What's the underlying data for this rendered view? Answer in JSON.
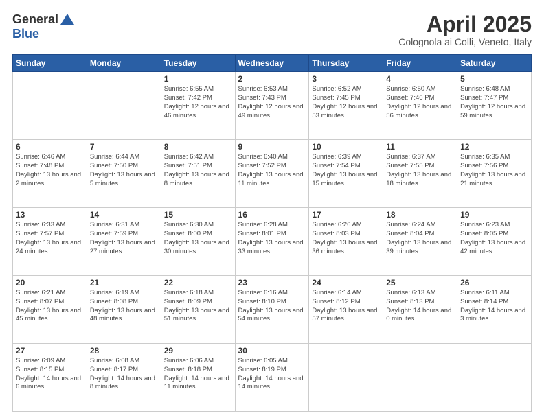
{
  "header": {
    "logo_general": "General",
    "logo_blue": "Blue",
    "month_title": "April 2025",
    "location": "Colognola ai Colli, Veneto, Italy"
  },
  "days_of_week": [
    "Sunday",
    "Monday",
    "Tuesday",
    "Wednesday",
    "Thursday",
    "Friday",
    "Saturday"
  ],
  "weeks": [
    [
      {
        "day": "",
        "info": ""
      },
      {
        "day": "",
        "info": ""
      },
      {
        "day": "1",
        "info": "Sunrise: 6:55 AM\nSunset: 7:42 PM\nDaylight: 12 hours and 46 minutes."
      },
      {
        "day": "2",
        "info": "Sunrise: 6:53 AM\nSunset: 7:43 PM\nDaylight: 12 hours and 49 minutes."
      },
      {
        "day": "3",
        "info": "Sunrise: 6:52 AM\nSunset: 7:45 PM\nDaylight: 12 hours and 53 minutes."
      },
      {
        "day": "4",
        "info": "Sunrise: 6:50 AM\nSunset: 7:46 PM\nDaylight: 12 hours and 56 minutes."
      },
      {
        "day": "5",
        "info": "Sunrise: 6:48 AM\nSunset: 7:47 PM\nDaylight: 12 hours and 59 minutes."
      }
    ],
    [
      {
        "day": "6",
        "info": "Sunrise: 6:46 AM\nSunset: 7:48 PM\nDaylight: 13 hours and 2 minutes."
      },
      {
        "day": "7",
        "info": "Sunrise: 6:44 AM\nSunset: 7:50 PM\nDaylight: 13 hours and 5 minutes."
      },
      {
        "day": "8",
        "info": "Sunrise: 6:42 AM\nSunset: 7:51 PM\nDaylight: 13 hours and 8 minutes."
      },
      {
        "day": "9",
        "info": "Sunrise: 6:40 AM\nSunset: 7:52 PM\nDaylight: 13 hours and 11 minutes."
      },
      {
        "day": "10",
        "info": "Sunrise: 6:39 AM\nSunset: 7:54 PM\nDaylight: 13 hours and 15 minutes."
      },
      {
        "day": "11",
        "info": "Sunrise: 6:37 AM\nSunset: 7:55 PM\nDaylight: 13 hours and 18 minutes."
      },
      {
        "day": "12",
        "info": "Sunrise: 6:35 AM\nSunset: 7:56 PM\nDaylight: 13 hours and 21 minutes."
      }
    ],
    [
      {
        "day": "13",
        "info": "Sunrise: 6:33 AM\nSunset: 7:57 PM\nDaylight: 13 hours and 24 minutes."
      },
      {
        "day": "14",
        "info": "Sunrise: 6:31 AM\nSunset: 7:59 PM\nDaylight: 13 hours and 27 minutes."
      },
      {
        "day": "15",
        "info": "Sunrise: 6:30 AM\nSunset: 8:00 PM\nDaylight: 13 hours and 30 minutes."
      },
      {
        "day": "16",
        "info": "Sunrise: 6:28 AM\nSunset: 8:01 PM\nDaylight: 13 hours and 33 minutes."
      },
      {
        "day": "17",
        "info": "Sunrise: 6:26 AM\nSunset: 8:03 PM\nDaylight: 13 hours and 36 minutes."
      },
      {
        "day": "18",
        "info": "Sunrise: 6:24 AM\nSunset: 8:04 PM\nDaylight: 13 hours and 39 minutes."
      },
      {
        "day": "19",
        "info": "Sunrise: 6:23 AM\nSunset: 8:05 PM\nDaylight: 13 hours and 42 minutes."
      }
    ],
    [
      {
        "day": "20",
        "info": "Sunrise: 6:21 AM\nSunset: 8:07 PM\nDaylight: 13 hours and 45 minutes."
      },
      {
        "day": "21",
        "info": "Sunrise: 6:19 AM\nSunset: 8:08 PM\nDaylight: 13 hours and 48 minutes."
      },
      {
        "day": "22",
        "info": "Sunrise: 6:18 AM\nSunset: 8:09 PM\nDaylight: 13 hours and 51 minutes."
      },
      {
        "day": "23",
        "info": "Sunrise: 6:16 AM\nSunset: 8:10 PM\nDaylight: 13 hours and 54 minutes."
      },
      {
        "day": "24",
        "info": "Sunrise: 6:14 AM\nSunset: 8:12 PM\nDaylight: 13 hours and 57 minutes."
      },
      {
        "day": "25",
        "info": "Sunrise: 6:13 AM\nSunset: 8:13 PM\nDaylight: 14 hours and 0 minutes."
      },
      {
        "day": "26",
        "info": "Sunrise: 6:11 AM\nSunset: 8:14 PM\nDaylight: 14 hours and 3 minutes."
      }
    ],
    [
      {
        "day": "27",
        "info": "Sunrise: 6:09 AM\nSunset: 8:15 PM\nDaylight: 14 hours and 6 minutes."
      },
      {
        "day": "28",
        "info": "Sunrise: 6:08 AM\nSunset: 8:17 PM\nDaylight: 14 hours and 8 minutes."
      },
      {
        "day": "29",
        "info": "Sunrise: 6:06 AM\nSunset: 8:18 PM\nDaylight: 14 hours and 11 minutes."
      },
      {
        "day": "30",
        "info": "Sunrise: 6:05 AM\nSunset: 8:19 PM\nDaylight: 14 hours and 14 minutes."
      },
      {
        "day": "",
        "info": ""
      },
      {
        "day": "",
        "info": ""
      },
      {
        "day": "",
        "info": ""
      }
    ]
  ]
}
